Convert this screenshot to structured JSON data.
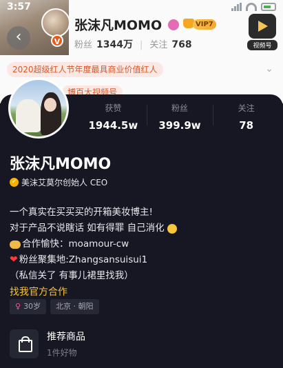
{
  "status_bar": {
    "time": "3:57"
  },
  "weibo_header": {
    "name": "张沫凡MOMO",
    "vip_label": "VIP7",
    "fans_label": "粉丝",
    "fans_value": "1344万",
    "follow_label": "关注",
    "follow_value": "768",
    "video_label": "视频号",
    "award_text": "2020超级红人节年度最具商业价值红人",
    "award2_text": "博百大视频号"
  },
  "profile": {
    "stats": [
      {
        "label": "获赞",
        "value": "1944.5w"
      },
      {
        "label": "粉丝",
        "value": "399.9w"
      },
      {
        "label": "关注",
        "value": "78"
      }
    ],
    "name": "张沫凡MOMO",
    "verification": "美沫艾莫尔创始人 CEO",
    "bio": {
      "line1": "一个真实在买买买的开箱美妆博主!",
      "line2": "对于产品不说瞎话 如有得罪 自己消化",
      "line3": "合作愉快：moamour-cw",
      "line4": "粉丝聚集地:Zhangsansuisui1",
      "line5": "（私信关了 有事儿裙里找我）"
    },
    "link_text": "找我官方合作",
    "tags": {
      "age": "30岁",
      "location": "北京 · 朝阳"
    },
    "shop": {
      "title": "推荐商品",
      "subtitle": "1件好物"
    }
  },
  "colors": {
    "card_bg": "#161722",
    "link": "#f3c23a",
    "award": "#d4592c"
  },
  "icons": [
    "back-arrow-icon",
    "verified-v-icon",
    "video-account-icon",
    "gender-female-icon",
    "shopping-bag-icon"
  ]
}
